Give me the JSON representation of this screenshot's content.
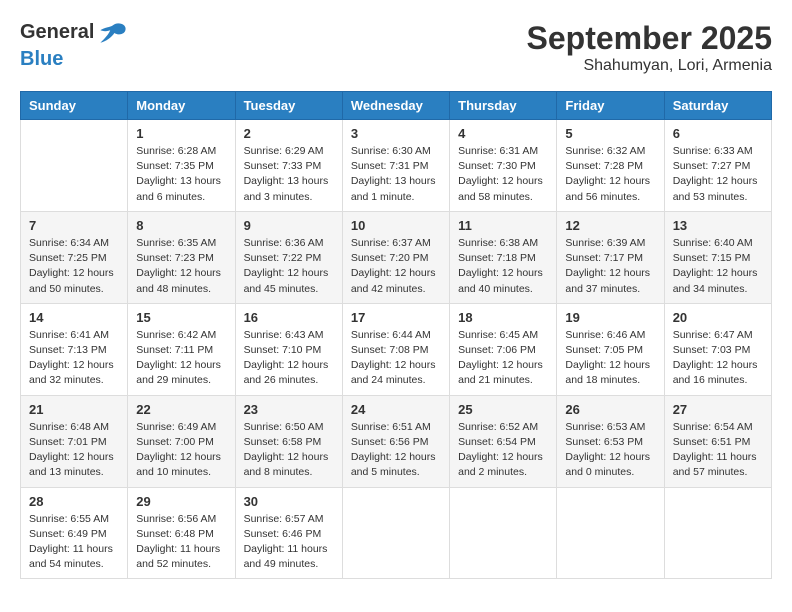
{
  "header": {
    "logo_general": "General",
    "logo_blue": "Blue",
    "month_title": "September 2025",
    "location": "Shahumyan, Lori, Armenia"
  },
  "days_of_week": [
    "Sunday",
    "Monday",
    "Tuesday",
    "Wednesday",
    "Thursday",
    "Friday",
    "Saturday"
  ],
  "weeks": [
    [
      {
        "day": "",
        "sunrise": "",
        "sunset": "",
        "daylight": ""
      },
      {
        "day": "1",
        "sunrise": "Sunrise: 6:28 AM",
        "sunset": "Sunset: 7:35 PM",
        "daylight": "Daylight: 13 hours and 6 minutes."
      },
      {
        "day": "2",
        "sunrise": "Sunrise: 6:29 AM",
        "sunset": "Sunset: 7:33 PM",
        "daylight": "Daylight: 13 hours and 3 minutes."
      },
      {
        "day": "3",
        "sunrise": "Sunrise: 6:30 AM",
        "sunset": "Sunset: 7:31 PM",
        "daylight": "Daylight: 13 hours and 1 minute."
      },
      {
        "day": "4",
        "sunrise": "Sunrise: 6:31 AM",
        "sunset": "Sunset: 7:30 PM",
        "daylight": "Daylight: 12 hours and 58 minutes."
      },
      {
        "day": "5",
        "sunrise": "Sunrise: 6:32 AM",
        "sunset": "Sunset: 7:28 PM",
        "daylight": "Daylight: 12 hours and 56 minutes."
      },
      {
        "day": "6",
        "sunrise": "Sunrise: 6:33 AM",
        "sunset": "Sunset: 7:27 PM",
        "daylight": "Daylight: 12 hours and 53 minutes."
      }
    ],
    [
      {
        "day": "7",
        "sunrise": "Sunrise: 6:34 AM",
        "sunset": "Sunset: 7:25 PM",
        "daylight": "Daylight: 12 hours and 50 minutes."
      },
      {
        "day": "8",
        "sunrise": "Sunrise: 6:35 AM",
        "sunset": "Sunset: 7:23 PM",
        "daylight": "Daylight: 12 hours and 48 minutes."
      },
      {
        "day": "9",
        "sunrise": "Sunrise: 6:36 AM",
        "sunset": "Sunset: 7:22 PM",
        "daylight": "Daylight: 12 hours and 45 minutes."
      },
      {
        "day": "10",
        "sunrise": "Sunrise: 6:37 AM",
        "sunset": "Sunset: 7:20 PM",
        "daylight": "Daylight: 12 hours and 42 minutes."
      },
      {
        "day": "11",
        "sunrise": "Sunrise: 6:38 AM",
        "sunset": "Sunset: 7:18 PM",
        "daylight": "Daylight: 12 hours and 40 minutes."
      },
      {
        "day": "12",
        "sunrise": "Sunrise: 6:39 AM",
        "sunset": "Sunset: 7:17 PM",
        "daylight": "Daylight: 12 hours and 37 minutes."
      },
      {
        "day": "13",
        "sunrise": "Sunrise: 6:40 AM",
        "sunset": "Sunset: 7:15 PM",
        "daylight": "Daylight: 12 hours and 34 minutes."
      }
    ],
    [
      {
        "day": "14",
        "sunrise": "Sunrise: 6:41 AM",
        "sunset": "Sunset: 7:13 PM",
        "daylight": "Daylight: 12 hours and 32 minutes."
      },
      {
        "day": "15",
        "sunrise": "Sunrise: 6:42 AM",
        "sunset": "Sunset: 7:11 PM",
        "daylight": "Daylight: 12 hours and 29 minutes."
      },
      {
        "day": "16",
        "sunrise": "Sunrise: 6:43 AM",
        "sunset": "Sunset: 7:10 PM",
        "daylight": "Daylight: 12 hours and 26 minutes."
      },
      {
        "day": "17",
        "sunrise": "Sunrise: 6:44 AM",
        "sunset": "Sunset: 7:08 PM",
        "daylight": "Daylight: 12 hours and 24 minutes."
      },
      {
        "day": "18",
        "sunrise": "Sunrise: 6:45 AM",
        "sunset": "Sunset: 7:06 PM",
        "daylight": "Daylight: 12 hours and 21 minutes."
      },
      {
        "day": "19",
        "sunrise": "Sunrise: 6:46 AM",
        "sunset": "Sunset: 7:05 PM",
        "daylight": "Daylight: 12 hours and 18 minutes."
      },
      {
        "day": "20",
        "sunrise": "Sunrise: 6:47 AM",
        "sunset": "Sunset: 7:03 PM",
        "daylight": "Daylight: 12 hours and 16 minutes."
      }
    ],
    [
      {
        "day": "21",
        "sunrise": "Sunrise: 6:48 AM",
        "sunset": "Sunset: 7:01 PM",
        "daylight": "Daylight: 12 hours and 13 minutes."
      },
      {
        "day": "22",
        "sunrise": "Sunrise: 6:49 AM",
        "sunset": "Sunset: 7:00 PM",
        "daylight": "Daylight: 12 hours and 10 minutes."
      },
      {
        "day": "23",
        "sunrise": "Sunrise: 6:50 AM",
        "sunset": "Sunset: 6:58 PM",
        "daylight": "Daylight: 12 hours and 8 minutes."
      },
      {
        "day": "24",
        "sunrise": "Sunrise: 6:51 AM",
        "sunset": "Sunset: 6:56 PM",
        "daylight": "Daylight: 12 hours and 5 minutes."
      },
      {
        "day": "25",
        "sunrise": "Sunrise: 6:52 AM",
        "sunset": "Sunset: 6:54 PM",
        "daylight": "Daylight: 12 hours and 2 minutes."
      },
      {
        "day": "26",
        "sunrise": "Sunrise: 6:53 AM",
        "sunset": "Sunset: 6:53 PM",
        "daylight": "Daylight: 12 hours and 0 minutes."
      },
      {
        "day": "27",
        "sunrise": "Sunrise: 6:54 AM",
        "sunset": "Sunset: 6:51 PM",
        "daylight": "Daylight: 11 hours and 57 minutes."
      }
    ],
    [
      {
        "day": "28",
        "sunrise": "Sunrise: 6:55 AM",
        "sunset": "Sunset: 6:49 PM",
        "daylight": "Daylight: 11 hours and 54 minutes."
      },
      {
        "day": "29",
        "sunrise": "Sunrise: 6:56 AM",
        "sunset": "Sunset: 6:48 PM",
        "daylight": "Daylight: 11 hours and 52 minutes."
      },
      {
        "day": "30",
        "sunrise": "Sunrise: 6:57 AM",
        "sunset": "Sunset: 6:46 PM",
        "daylight": "Daylight: 11 hours and 49 minutes."
      },
      {
        "day": "",
        "sunrise": "",
        "sunset": "",
        "daylight": ""
      },
      {
        "day": "",
        "sunrise": "",
        "sunset": "",
        "daylight": ""
      },
      {
        "day": "",
        "sunrise": "",
        "sunset": "",
        "daylight": ""
      },
      {
        "day": "",
        "sunrise": "",
        "sunset": "",
        "daylight": ""
      }
    ]
  ]
}
